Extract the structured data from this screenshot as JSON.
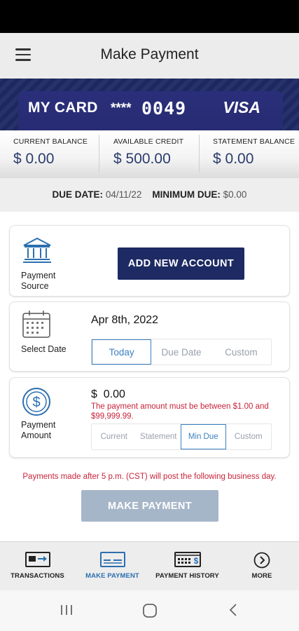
{
  "header": {
    "title": "Make Payment"
  },
  "card": {
    "name": "MY CARD",
    "mask": "****",
    "last_digits": "0049",
    "brand": "VISA",
    "color": "#1d2a63"
  },
  "balances": [
    {
      "label": "CURRENT BALANCE",
      "value": "$ 0.00"
    },
    {
      "label": "AVAILABLE CREDIT",
      "value": "$ 500.00"
    },
    {
      "label": "STATEMENT BALANCE",
      "value": "$ 0.00"
    }
  ],
  "due": {
    "date_label": "DUE DATE:",
    "date_value": "04/11/22",
    "min_label": "MINIMUM DUE:",
    "min_value": "$0.00"
  },
  "payment_source": {
    "label_line1": "Payment",
    "label_line2": "Source",
    "add_button": "ADD NEW ACCOUNT",
    "icon": "bank-icon"
  },
  "select_date": {
    "label": "Select Date",
    "value": "Apr 8th, 2022",
    "options": [
      "Today",
      "Due Date",
      "Custom"
    ],
    "selected": "Today",
    "icon": "calendar-icon"
  },
  "payment_amount": {
    "label_line1": "Payment",
    "label_line2": "Amount",
    "value": "$  0.00",
    "error": "The payment amount must be between $1.00 and $99,999.99.",
    "options": [
      "Current",
      "Statement",
      "Min Due",
      "Custom"
    ],
    "selected": "Min Due",
    "icon": "dollar-circle-icon"
  },
  "notice": "Payments made after 5 p.m. (CST) will post the following business day.",
  "make_payment_button": "MAKE PAYMENT",
  "bottom_nav": [
    {
      "label": "TRANSACTIONS",
      "icon": "transactions-icon",
      "active": false
    },
    {
      "label": "MAKE PAYMENT",
      "icon": "make-payment-icon",
      "active": true
    },
    {
      "label": "PAYMENT HISTORY",
      "icon": "payment-history-icon",
      "active": false
    },
    {
      "label": "MORE",
      "icon": "chevron-right-circle-icon",
      "active": false
    }
  ],
  "colors": {
    "accent": "#1d2a63",
    "link_blue": "#3a7fc2",
    "error": "#c8243a",
    "disabled_button": "#a6b6c9"
  }
}
